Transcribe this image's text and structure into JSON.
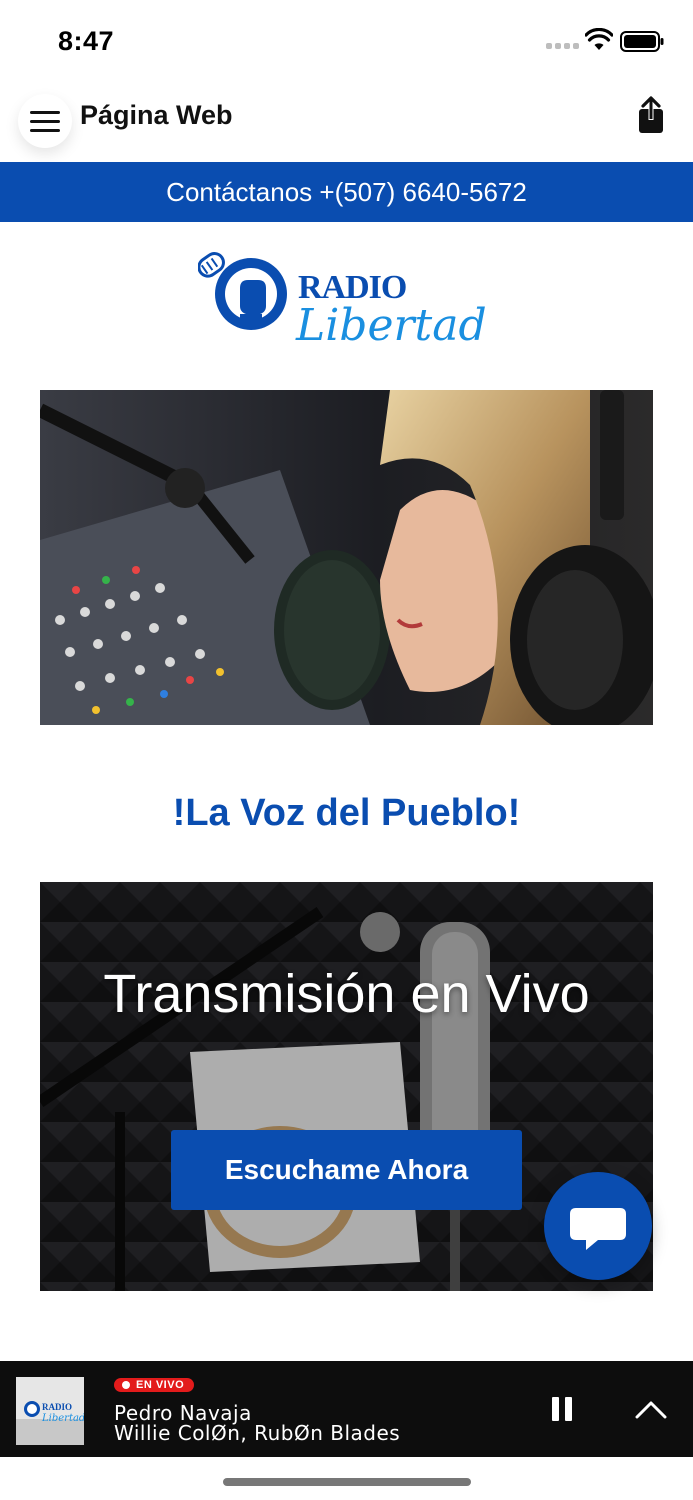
{
  "status_bar": {
    "time": "8:47"
  },
  "header": {
    "title": "Página Web"
  },
  "contact": {
    "text": "Contáctanos +(507) 6640-5672"
  },
  "logo": {
    "word1": "RADIO",
    "word2": "Libertad"
  },
  "slogan": "!La Voz del Pueblo!",
  "live_card": {
    "title": "Transmisión en Vivo",
    "button_label": "Escuchame Ahora"
  },
  "player": {
    "badge": "EN VIVO",
    "title": "Pedro Navaja",
    "artist": "Willie ColØn, RubØn Blades",
    "art_word1": "RADIO",
    "art_word2": "Libertad"
  },
  "colors": {
    "brand_blue": "#0a4db0",
    "live_red": "#e31b1b",
    "player_bg": "#0d0d0d"
  },
  "icons": [
    "menu-icon",
    "share-icon",
    "chat-icon",
    "pause-icon",
    "chevron-up-icon",
    "wifi-icon",
    "battery-icon",
    "signal-icon"
  ]
}
